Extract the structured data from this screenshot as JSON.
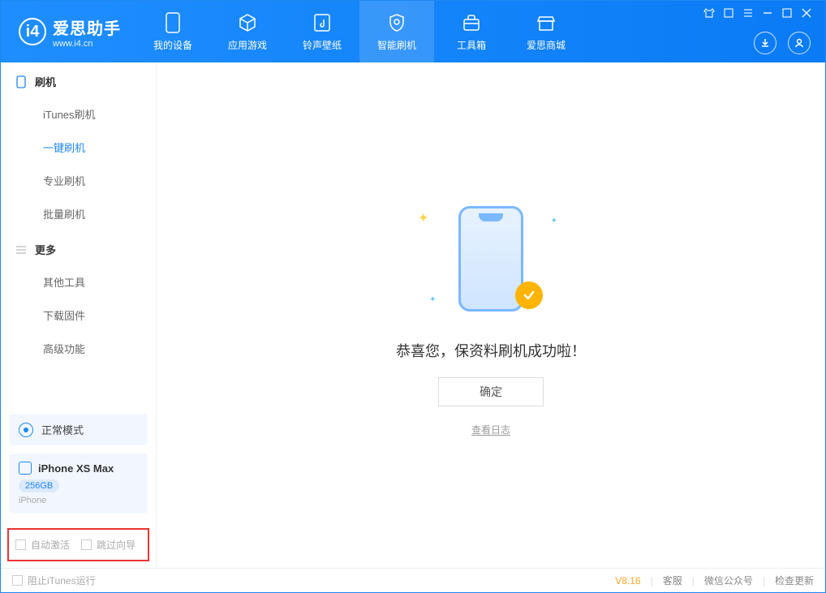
{
  "app": {
    "title": "爱思助手",
    "subtitle": "www.i4.cn"
  },
  "tabs": [
    {
      "label": "我的设备"
    },
    {
      "label": "应用游戏"
    },
    {
      "label": "铃声壁纸"
    },
    {
      "label": "智能刷机"
    },
    {
      "label": "工具箱"
    },
    {
      "label": "爱思商城"
    }
  ],
  "sidebar": {
    "section1_title": "刷机",
    "items1": [
      {
        "label": "iTunes刷机"
      },
      {
        "label": "一键刷机"
      },
      {
        "label": "专业刷机"
      },
      {
        "label": "批量刷机"
      }
    ],
    "section2_title": "更多",
    "items2": [
      {
        "label": "其他工具"
      },
      {
        "label": "下载固件"
      },
      {
        "label": "高级功能"
      }
    ],
    "mode": "正常模式",
    "device": {
      "name": "iPhone XS Max",
      "storage": "256GB",
      "type": "iPhone"
    },
    "checkboxes": {
      "auto_activate": "自动激活",
      "skip_guide": "跳过向导"
    }
  },
  "main": {
    "success_text": "恭喜您，保资料刷机成功啦！",
    "ok_button": "确定",
    "log_link": "查看日志"
  },
  "footer": {
    "block_itunes": "阻止iTunes运行",
    "version": "V8.16",
    "links": {
      "service": "客服",
      "wechat": "微信公众号",
      "update": "检查更新"
    }
  }
}
